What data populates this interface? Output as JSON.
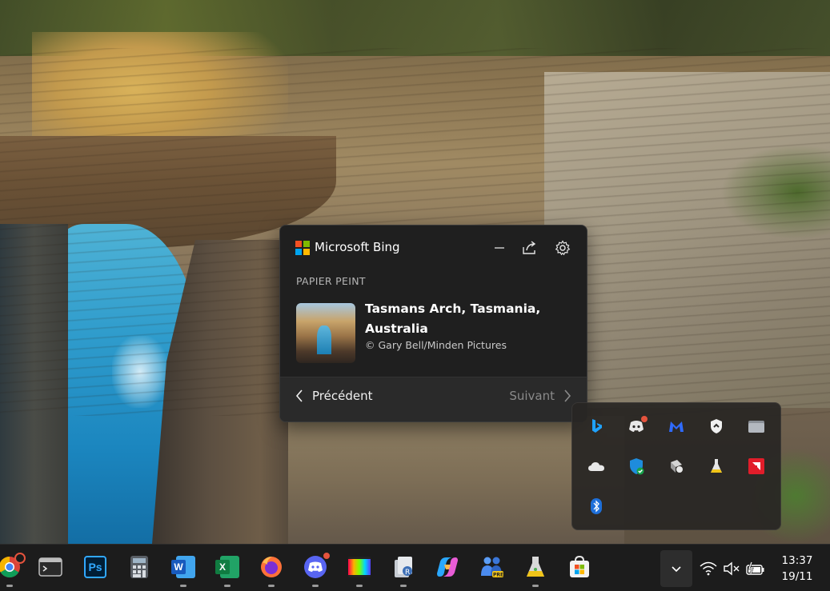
{
  "bing_widget": {
    "app_name": "Microsoft Bing",
    "section": "PAPIER PEINT",
    "image_title": "Tasmans Arch, Tasmania, Australia",
    "image_credit": "© Gary Bell/Minden Pictures",
    "prev_label": "Précédent",
    "next_label": "Suivant",
    "logo_colors": [
      "#f25022",
      "#7fba00",
      "#00a4ef",
      "#ffb900"
    ]
  },
  "tray_overflow": {
    "icons": [
      "bing-icon",
      "discord-tray-icon",
      "malwarebytes-icon",
      "vpn-shield-icon",
      "folder-icon",
      "onedrive-icon",
      "windows-security-icon",
      "printer-app-icon",
      "flask-icon",
      "amd-icon",
      "bluetooth-icon"
    ]
  },
  "taskbar": {
    "apps": [
      "chrome",
      "terminal",
      "photoshop",
      "calculator",
      "word",
      "excel",
      "firefox",
      "discord",
      "media-player",
      "file-manager",
      "copilot",
      "teams-preview",
      "flask-app",
      "microsoft-store"
    ],
    "photoshop_label": "Ps",
    "word_label": "W",
    "excel_label": "X"
  },
  "clock": {
    "time": "13:37",
    "date": "19/11"
  },
  "colors": {
    "accent": "#0078d4",
    "taskbar_bg": "#1c1c1c",
    "popup_bg": "#1f1f1f"
  }
}
